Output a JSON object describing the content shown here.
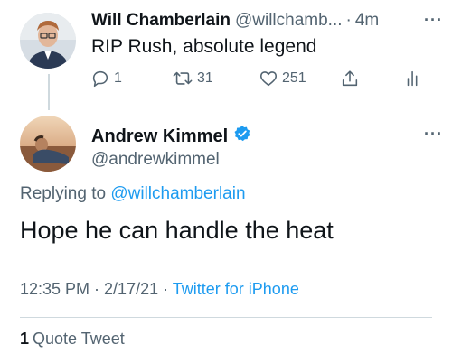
{
  "parent_tweet": {
    "display_name": "Will Chamberlain",
    "handle": "@willchamb...",
    "separator": "·",
    "time": "4m",
    "more": "···",
    "text": "RIP Rush, absolute legend",
    "reply_count": "1",
    "retweet_count": "31",
    "like_count": "251"
  },
  "main_tweet": {
    "display_name": "Andrew Kimmel",
    "handle": "@andrewkimmel",
    "more": "···",
    "replying_prefix": "Replying to",
    "replying_to": "@willchamberlain",
    "text": "Hope he can handle the heat",
    "timestamp": "12:35 PM · 2/17/21 ·",
    "source": "Twitter for iPhone",
    "quote_count": "1",
    "quote_label": "Quote Tweet"
  },
  "colors": {
    "accent": "#1d9bf0",
    "secondary_text": "#536471",
    "divider": "#cfd9de"
  },
  "icons": {
    "reply": "reply-icon",
    "retweet": "retweet-icon",
    "like": "heart-icon",
    "share": "share-icon",
    "analytics": "analytics-icon",
    "verified": "verified-badge-icon"
  }
}
